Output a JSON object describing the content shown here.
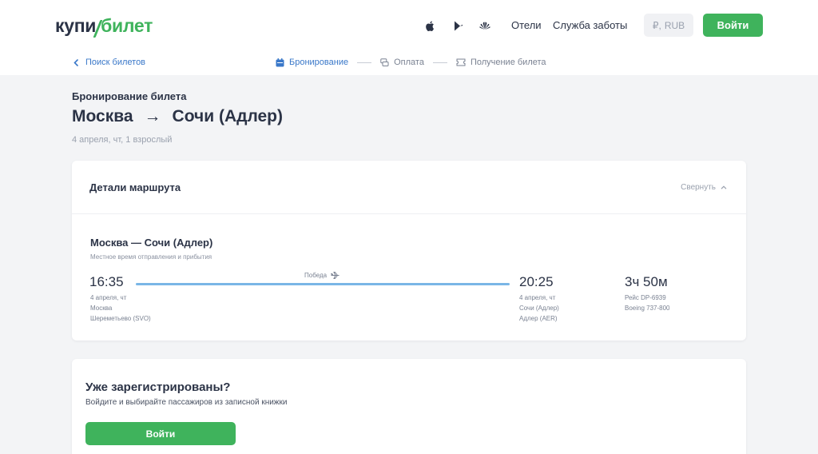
{
  "header": {
    "logo_part1": "купи",
    "logo_part2": "билет",
    "nav": {
      "hotels": "Отели",
      "support": "Служба заботы"
    },
    "currency": {
      "symbol": "₽,",
      "code": "RUB"
    },
    "login": "Войти",
    "icons": [
      "apple-icon",
      "google-play-icon",
      "huawei-icon"
    ]
  },
  "breadcrumb": {
    "back": "Поиск билетов",
    "steps": [
      {
        "label": "Бронирование",
        "active": true
      },
      {
        "label": "Оплата",
        "active": false
      },
      {
        "label": "Получение билета",
        "active": false
      }
    ]
  },
  "page": {
    "subtitle": "Бронирование билета",
    "from": "Москва",
    "arrow": "→",
    "to": "Сочи (Адлер)",
    "meta": "4 апреля, чт, 1 взрослый"
  },
  "route_card": {
    "title": "Детали маршрута",
    "collapse": "Свернуть",
    "segment_title": "Москва — Сочи (Адлер)",
    "segment_sub": "Местное время отправления и прибытия",
    "departure": {
      "time": "16:35",
      "date": "4 апреля, чт",
      "city": "Москва",
      "airport": "Шереметьево (SVO)"
    },
    "carrier": "Победа",
    "arrival": {
      "time": "20:25",
      "date": "4 апреля, чт",
      "city": "Сочи (Адлер)",
      "airport": "Адлер (AER)"
    },
    "duration": "3ч 50м",
    "flight": "Рейс DP-6939",
    "aircraft": "Boeing 737-800"
  },
  "register_card": {
    "title": "Уже зарегистрированы?",
    "subtitle": "Войдите и выбирайте пассажиров из записной книжки",
    "button": "Войти"
  },
  "colors": {
    "brand_green": "#3fb35c",
    "link_blue": "#3a78c9",
    "line_blue": "#7ab6e6"
  }
}
